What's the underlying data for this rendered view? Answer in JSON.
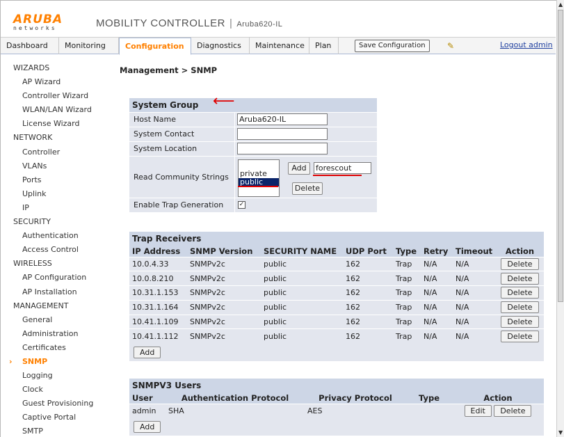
{
  "header": {
    "logo_main": "ARUBA",
    "logo_sub": "networks",
    "app_title": "MOBILITY CONTROLLER",
    "separator": "|",
    "host": "Aruba620-IL"
  },
  "nav": {
    "tabs": [
      "Dashboard",
      "Monitoring",
      "Configuration",
      "Diagnostics",
      "Maintenance",
      "Plan"
    ],
    "active_tab": "Configuration",
    "save_label": "Save Configuration",
    "logout_label": "Logout admin"
  },
  "sidebar": [
    {
      "label": "WIZARDS",
      "type": "head"
    },
    {
      "label": "AP Wizard",
      "type": "item"
    },
    {
      "label": "Controller Wizard",
      "type": "item"
    },
    {
      "label": "WLAN/LAN Wizard",
      "type": "item"
    },
    {
      "label": "License Wizard",
      "type": "item"
    },
    {
      "label": "NETWORK",
      "type": "head"
    },
    {
      "label": "Controller",
      "type": "item"
    },
    {
      "label": "VLANs",
      "type": "item"
    },
    {
      "label": "Ports",
      "type": "item"
    },
    {
      "label": "Uplink",
      "type": "item"
    },
    {
      "label": "IP",
      "type": "item"
    },
    {
      "label": "SECURITY",
      "type": "head"
    },
    {
      "label": "Authentication",
      "type": "item"
    },
    {
      "label": "Access Control",
      "type": "item"
    },
    {
      "label": "WIRELESS",
      "type": "head"
    },
    {
      "label": "AP Configuration",
      "type": "item"
    },
    {
      "label": "AP Installation",
      "type": "item"
    },
    {
      "label": "MANAGEMENT",
      "type": "head"
    },
    {
      "label": "General",
      "type": "item"
    },
    {
      "label": "Administration",
      "type": "item"
    },
    {
      "label": "Certificates",
      "type": "item"
    },
    {
      "label": "SNMP",
      "type": "active"
    },
    {
      "label": "Logging",
      "type": "item"
    },
    {
      "label": "Clock",
      "type": "item"
    },
    {
      "label": "Guest Provisioning",
      "type": "item"
    },
    {
      "label": "Captive Portal",
      "type": "item"
    },
    {
      "label": "SMTP",
      "type": "item"
    }
  ],
  "page_title": "Management > SNMP",
  "system_group": {
    "title": "System Group",
    "host_name_label": "Host Name",
    "host_name_value": "Aruba620-IL",
    "contact_label": "System Contact",
    "contact_value": "",
    "location_label": "System Location",
    "location_value": "",
    "community_label": "Read Community Strings",
    "community_items": [
      "private",
      "public"
    ],
    "community_selected": "public",
    "add_label": "Add",
    "delete_label": "Delete",
    "community_input": "forescout",
    "trap_label": "Enable Trap Generation",
    "trap_checked": "✓"
  },
  "trap_receivers": {
    "title": "Trap Receivers",
    "columns": [
      "IP Address",
      "SNMP Version",
      "SECURITY NAME",
      "UDP Port",
      "Type",
      "Retry",
      "Timeout",
      "Action"
    ],
    "rows": [
      [
        "10.0.4.33",
        "SNMPv2c",
        "public",
        "162",
        "Trap",
        "N/A",
        "N/A",
        "Delete"
      ],
      [
        "10.0.8.210",
        "SNMPv2c",
        "public",
        "162",
        "Trap",
        "N/A",
        "N/A",
        "Delete"
      ],
      [
        "10.31.1.153",
        "SNMPv2c",
        "public",
        "162",
        "Trap",
        "N/A",
        "N/A",
        "Delete"
      ],
      [
        "10.31.1.164",
        "SNMPv2c",
        "public",
        "162",
        "Trap",
        "N/A",
        "N/A",
        "Delete"
      ],
      [
        "10.41.1.109",
        "SNMPv2c",
        "public",
        "162",
        "Trap",
        "N/A",
        "N/A",
        "Delete"
      ],
      [
        "10.41.1.112",
        "SNMPv2c",
        "public",
        "162",
        "Trap",
        "N/A",
        "N/A",
        "Delete"
      ]
    ],
    "add_label": "Add"
  },
  "snmpv3_users": {
    "title": "SNMPV3 Users",
    "columns": [
      "User",
      "Authentication Protocol",
      "Privacy Protocol",
      "Type",
      "Action"
    ],
    "rows": [
      {
        "user": "admin",
        "auth": "SHA",
        "privacy": "AES",
        "type": "",
        "edit": "Edit",
        "delete": "Delete"
      }
    ],
    "add_label": "Add"
  },
  "colors": {
    "accent": "#ff8000",
    "panel_header": "#cdd6e6",
    "panel_body": "#e3e6ee",
    "annotation": "#e00000"
  }
}
